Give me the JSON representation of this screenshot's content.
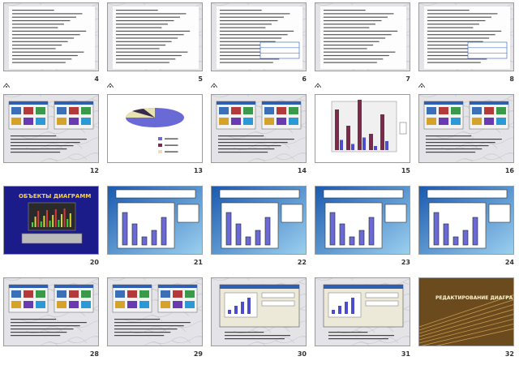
{
  "slides": [
    {
      "number": "4",
      "has_icon": true,
      "kind": "text"
    },
    {
      "number": "5",
      "has_icon": true,
      "kind": "text"
    },
    {
      "number": "6",
      "has_icon": true,
      "kind": "text-table"
    },
    {
      "number": "7",
      "has_icon": true,
      "kind": "text"
    },
    {
      "number": "8",
      "has_icon": true,
      "kind": "text-table"
    },
    {
      "number": "12",
      "has_icon": false,
      "kind": "screenshots"
    },
    {
      "number": "13",
      "has_icon": false,
      "kind": "pie"
    },
    {
      "number": "14",
      "has_icon": false,
      "kind": "screenshots"
    },
    {
      "number": "15",
      "has_icon": false,
      "kind": "bar3d"
    },
    {
      "number": "16",
      "has_icon": false,
      "kind": "screenshots"
    },
    {
      "number": "20",
      "has_icon": false,
      "kind": "title-image",
      "title": "ОБЪЕКТЫ ДИАГРАММ"
    },
    {
      "number": "21",
      "has_icon": false,
      "kind": "blue-chart"
    },
    {
      "number": "22",
      "has_icon": false,
      "kind": "blue-chart"
    },
    {
      "number": "23",
      "has_icon": false,
      "kind": "blue-chart"
    },
    {
      "number": "24",
      "has_icon": false,
      "kind": "blue-chart"
    },
    {
      "number": "28",
      "has_icon": false,
      "kind": "screenshots"
    },
    {
      "number": "29",
      "has_icon": false,
      "kind": "screenshots"
    },
    {
      "number": "30",
      "has_icon": false,
      "kind": "dialog"
    },
    {
      "number": "31",
      "has_icon": false,
      "kind": "dialog"
    },
    {
      "number": "32",
      "has_icon": false,
      "kind": "title-sepia",
      "title": "РЕДАКТИРОВАНИЕ ДИАГРАММЫ"
    }
  ],
  "colors": {
    "selection": "#3d6bd6",
    "bar": "#7b2a4c",
    "bar_alt": "#4d4dcc",
    "blue_bg": "#3a8ad6"
  }
}
